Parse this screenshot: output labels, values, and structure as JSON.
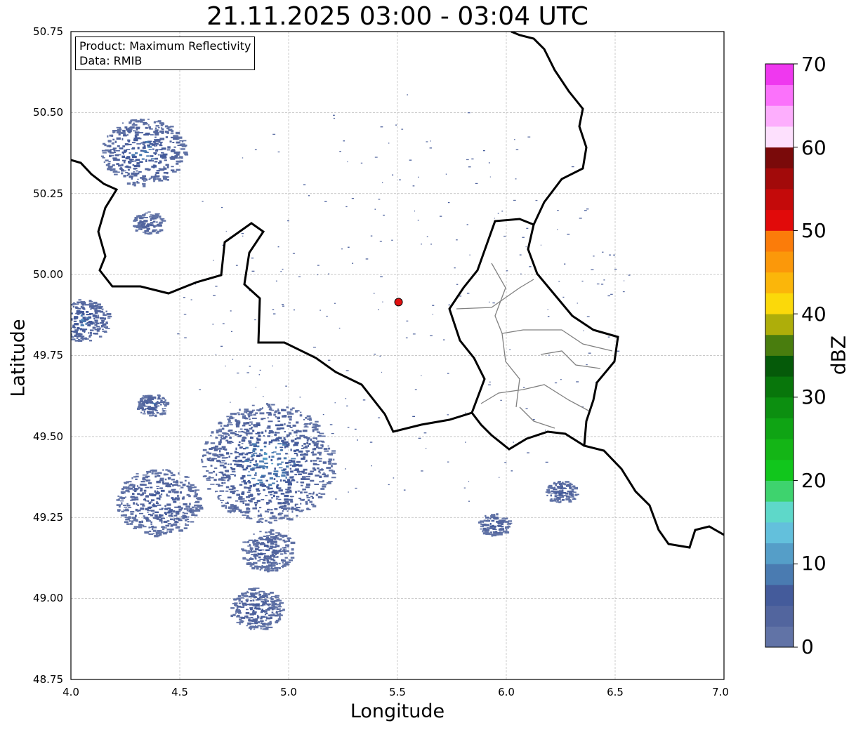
{
  "title": "21.11.2025 03:00 - 03:04 UTC",
  "info_box": {
    "product": "Product: Maximum Reflectivity",
    "data": "Data: RMIB"
  },
  "x_axis": {
    "label": "Longitude",
    "range": [
      4.0,
      7.0
    ],
    "ticks": [
      "4.0",
      "4.5",
      "5.0",
      "5.5",
      "6.0",
      "6.5",
      "7.0"
    ]
  },
  "y_axis": {
    "label": "Latitude",
    "range": [
      48.75,
      50.75
    ],
    "ticks": [
      "50.75",
      "50.50",
      "50.25",
      "50.00",
      "49.75",
      "49.50",
      "49.25",
      "49.00",
      "48.75"
    ]
  },
  "grid": true,
  "colorbar": {
    "label": "dBZ",
    "range": [
      0,
      70
    ],
    "step": 5,
    "ticks": [
      "70",
      "60",
      "50",
      "40",
      "30",
      "20",
      "10",
      "0"
    ],
    "colors": [
      "#6173a6",
      "#52659e",
      "#445b9b",
      "#4a7bb1",
      "#559ec8",
      "#63c0dc",
      "#5ed8c9",
      "#3ed36e",
      "#11c61c",
      "#14b516",
      "#0fa414",
      "#0c8f10",
      "#08760b",
      "#055a09",
      "#497d0e",
      "#aeae0a",
      "#fbd90a",
      "#fbb60a",
      "#fb980a",
      "#fb7c0a",
      "#e10a0a",
      "#c40a0a",
      "#a20a0a",
      "#7a0a0a",
      "#fde0fd",
      "#fdaefd",
      "#fb72fb",
      "#ef38ef"
    ]
  },
  "radar_site": {
    "lon": 5.505,
    "lat": 49.915,
    "color": "#e11010"
  },
  "echo_cells": [
    {
      "lon": 4.33,
      "lat": 50.38,
      "size": "large",
      "max_dbz": 22
    },
    {
      "lon": 4.05,
      "lat": 49.86,
      "size": "medium",
      "max_dbz": 22
    },
    {
      "lon": 4.37,
      "lat": 49.6,
      "size": "small",
      "max_dbz": 18
    },
    {
      "lon": 4.4,
      "lat": 49.3,
      "size": "large",
      "max_dbz": 17
    },
    {
      "lon": 4.9,
      "lat": 49.42,
      "size": "very-large",
      "max_dbz": 24
    },
    {
      "lon": 4.9,
      "lat": 49.15,
      "size": "medium",
      "max_dbz": 15
    },
    {
      "lon": 4.85,
      "lat": 48.97,
      "size": "medium",
      "max_dbz": 16
    },
    {
      "lon": 5.94,
      "lat": 49.23,
      "size": "small",
      "max_dbz": 16
    },
    {
      "lon": 6.25,
      "lat": 49.33,
      "size": "small",
      "max_dbz": 16
    },
    {
      "lon": 4.35,
      "lat": 50.16,
      "size": "small",
      "max_dbz": 14
    }
  ],
  "borders": {
    "country_color": "#000000",
    "admin_color": "#808080"
  }
}
